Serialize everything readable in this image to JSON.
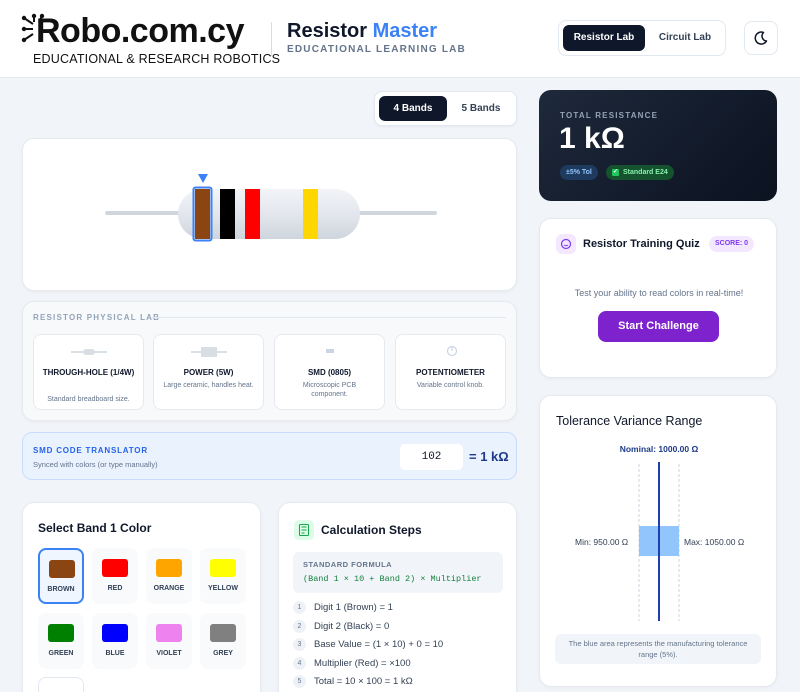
{
  "brand": {
    "name": "Robo.com.cy",
    "tagline": "EDUCATIONAL & RESEARCH ROBOTICS"
  },
  "app": {
    "title_main": "Resistor",
    "title_accent": "Master",
    "subtitle": "EDUCATIONAL LEARNING LAB"
  },
  "mode_tabs": [
    {
      "label": "Resistor Lab",
      "active": true
    },
    {
      "label": "Circuit Lab",
      "active": false
    }
  ],
  "theme_toggle_icon": "moon-icon",
  "band_tabs": [
    {
      "label": "4 Bands",
      "active": true
    },
    {
      "label": "5 Bands",
      "active": false
    }
  ],
  "resistor": {
    "selected_band_index": 0,
    "bands": [
      {
        "name": "Brown",
        "color": "#8b4513"
      },
      {
        "name": "Black",
        "color": "#000000"
      },
      {
        "name": "Red",
        "color": "#ff0000"
      },
      {
        "name": "Gold",
        "color": "#ffd700"
      }
    ]
  },
  "result": {
    "label": "TOTAL RESISTANCE",
    "value": "1 kΩ",
    "tolerance_badge": "±5% Tol",
    "standard_badge": "Standard E24"
  },
  "quiz": {
    "title": "Resistor Training Quiz",
    "score": "SCORE: 0",
    "prompt": "Test your ability to read colors in real-time!",
    "button": "Start Challenge"
  },
  "physical_lab": {
    "title": "RESISTOR PHYSICAL LAB",
    "types": [
      {
        "name": "THROUGH-HOLE (1/4W)",
        "desc": "Standard breadboard size.",
        "icon": "through-hole-resistor-icon"
      },
      {
        "name": "POWER (5W)",
        "desc": "Large ceramic, handles heat.",
        "icon": "power-resistor-icon"
      },
      {
        "name": "SMD (0805)",
        "desc": "Microscopic PCB component.",
        "icon": "smd-resistor-icon"
      },
      {
        "name": "POTENTIOMETER",
        "desc": "Variable control knob.",
        "icon": "potentiometer-icon"
      }
    ]
  },
  "smd": {
    "title": "SMD CODE TRANSLATOR",
    "subtitle": "Synced with colors (or type manually)",
    "code": "102",
    "result": "= 1 kΩ"
  },
  "band_selector": {
    "title": "Select Band 1 Color",
    "selected": "BROWN",
    "colors": [
      {
        "name": "BROWN",
        "hex": "#8b4513"
      },
      {
        "name": "RED",
        "hex": "#ff0000"
      },
      {
        "name": "ORANGE",
        "hex": "#ffa500"
      },
      {
        "name": "YELLOW",
        "hex": "#ffff00"
      },
      {
        "name": "GREEN",
        "hex": "#008000"
      },
      {
        "name": "BLUE",
        "hex": "#0000ff"
      },
      {
        "name": "VIOLET",
        "hex": "#ee82ee"
      },
      {
        "name": "GREY",
        "hex": "#808080"
      }
    ]
  },
  "calc": {
    "title": "Calculation Steps",
    "formula_label": "STANDARD FORMULA",
    "formula": "(Band 1 × 10 + Band 2) × Multiplier",
    "steps": [
      {
        "num": "1",
        "text": "Digit 1 (Brown) = 1"
      },
      {
        "num": "2",
        "text": "Digit 2 (Black) = 0"
      },
      {
        "num": "3",
        "text": "Base Value = (1 × 10) + 0 = 10"
      },
      {
        "num": "4",
        "text": "Multiplier (Red) = ×100"
      },
      {
        "num": "5",
        "text": "Total = 10 × 100 = 1 kΩ"
      }
    ]
  },
  "tolerance": {
    "title": "Tolerance Variance Range",
    "nominal": "Nominal: 1000.00 Ω",
    "min": "Min: 950.00 Ω",
    "max": "Max: 1050.00 Ω",
    "note": "The blue area represents the manufacturing tolerance range (5%)."
  }
}
